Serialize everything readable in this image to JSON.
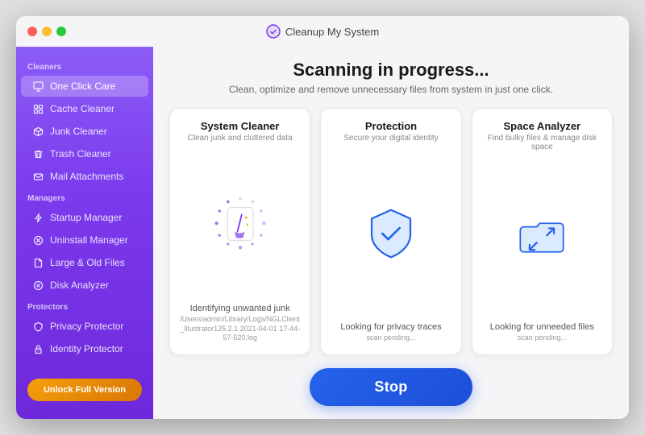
{
  "window": {
    "title": "Cleanup My System"
  },
  "sidebar": {
    "cleaners_label": "Cleaners",
    "managers_label": "Managers",
    "protectors_label": "Protectors",
    "items_cleaners": [
      {
        "label": "One Click Care",
        "active": true,
        "icon": "monitor"
      },
      {
        "label": "Cache Cleaner",
        "active": false,
        "icon": "grid"
      },
      {
        "label": "Junk Cleaner",
        "active": false,
        "icon": "package"
      },
      {
        "label": "Trash Cleaner",
        "active": false,
        "icon": "trash"
      },
      {
        "label": "Mail Attachments",
        "active": false,
        "icon": "mail"
      }
    ],
    "items_managers": [
      {
        "label": "Startup Manager",
        "active": false,
        "icon": "zap"
      },
      {
        "label": "Uninstall Manager",
        "active": false,
        "icon": "x-circle"
      },
      {
        "label": "Large & Old Files",
        "active": false,
        "icon": "file"
      },
      {
        "label": "Disk Analyzer",
        "active": false,
        "icon": "disc"
      }
    ],
    "items_protectors": [
      {
        "label": "Privacy Protector",
        "active": false,
        "icon": "shield"
      },
      {
        "label": "Identity Protector",
        "active": false,
        "icon": "lock"
      }
    ],
    "unlock_label": "Unlock Full Version"
  },
  "content": {
    "scanning_title": "Scanning in progress...",
    "scanning_subtitle": "Clean, optimize and remove unnecessary files from system in just one click.",
    "cards": [
      {
        "title": "System Cleaner",
        "subtitle": "Clean junk and cluttered data",
        "status_text": "Identifying unwanted junk",
        "status_detail": "/Users/admin/Library/Logs/NGLClient_Illustrator125.2.1 2021-04-01 17-44-57-520.log",
        "type": "system-cleaner"
      },
      {
        "title": "Protection",
        "subtitle": "Secure your digital identity",
        "status_text": "Looking for privacy traces",
        "status_detail": "scan pending...",
        "type": "protection"
      },
      {
        "title": "Space Analyzer",
        "subtitle": "Find bulky files & manage disk space",
        "status_text": "Looking for unneeded files",
        "status_detail": "scan pending...",
        "type": "space-analyzer"
      }
    ],
    "stop_button_label": "Stop"
  }
}
